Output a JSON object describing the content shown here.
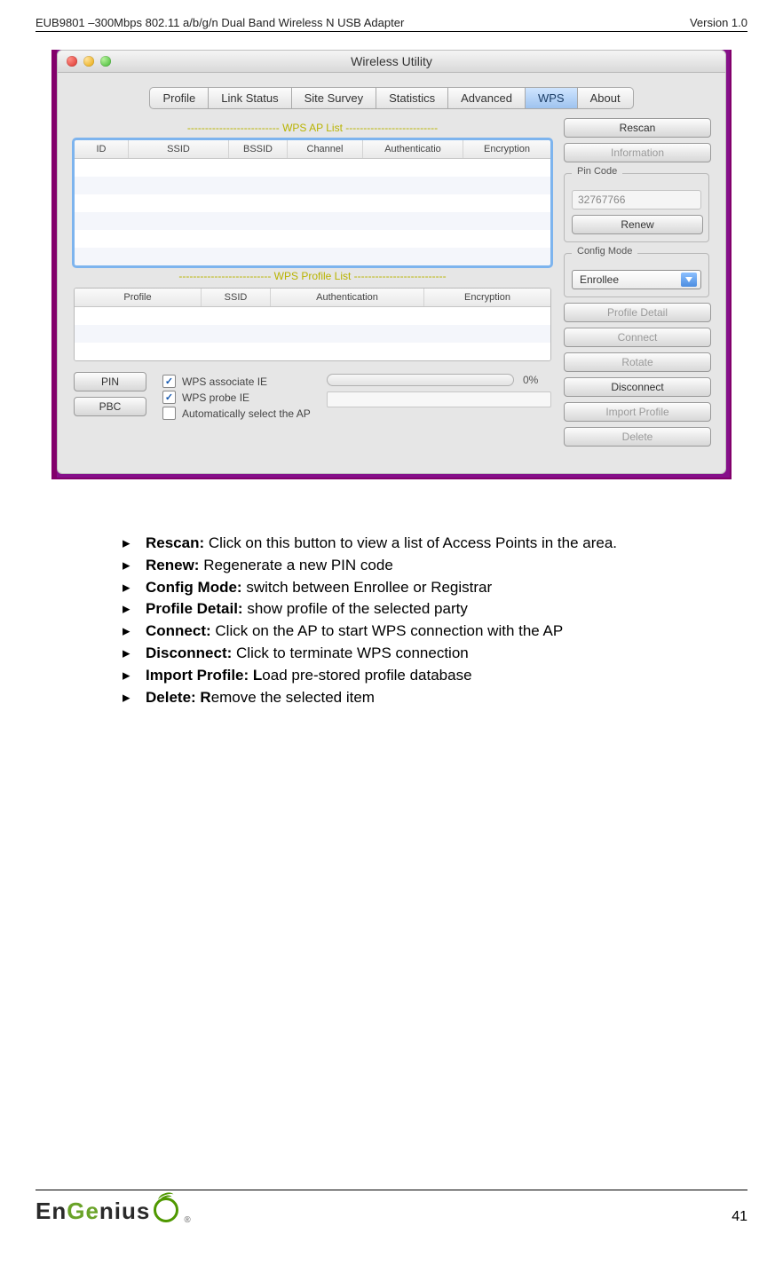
{
  "header": {
    "left": "EUB9801 –300Mbps 802.11 a/b/g/n Dual Band Wireless N USB Adapter",
    "right": "Version 1.0"
  },
  "window": {
    "title": "Wireless Utility",
    "tabs": [
      "Profile",
      "Link Status",
      "Site Survey",
      "Statistics",
      "Advanced",
      "WPS",
      "About"
    ],
    "activeTab": "WPS",
    "apListTitle": "-------------------------- WPS AP List --------------------------",
    "apCols": [
      "ID",
      "SSID",
      "BSSID",
      "Channel",
      "Authenticatio",
      "Encryption"
    ],
    "profileListTitle": "-------------------------- WPS Profile List --------------------------",
    "profileCols": [
      "Profile",
      "SSID",
      "Authentication",
      "Encryption"
    ],
    "side": {
      "rescan": "Rescan",
      "information": "Information",
      "pinCodeLabel": "Pin Code",
      "pinCode": "32767766",
      "renew": "Renew",
      "configModeLabel": "Config Mode",
      "configMode": "Enrollee",
      "profileDetail": "Profile Detail",
      "connect": "Connect",
      "rotate": "Rotate",
      "disconnect": "Disconnect",
      "importProfile": "Import Profile",
      "delete": "Delete"
    },
    "bottom": {
      "pinBtn": "PIN",
      "pbcBtn": "PBC",
      "chk1": "WPS associate IE",
      "chk2": "WPS probe IE",
      "chk3": "Automatically select the AP",
      "progress": "0%"
    }
  },
  "bullets": [
    {
      "b": "Rescan:",
      "t": " Click on this button to view a list of Access Points in the area."
    },
    {
      "b": "Renew:",
      "t": " Regenerate a new PIN code"
    },
    {
      "b": "Config Mode:",
      "t": " switch between Enrollee or Registrar"
    },
    {
      "b": "Profile Detail:",
      "t": " show profile of the selected party"
    },
    {
      "b": "Connect:",
      "t": " Click on the AP to start WPS connection with the AP"
    },
    {
      "b": "Disconnect:",
      "t": " Click to terminate WPS connection"
    },
    {
      "b": "Import Profile: L",
      "t": "oad pre-stored profile database"
    },
    {
      "b": "Delete: R",
      "t": "emove the selected item"
    }
  ],
  "footer": {
    "logoText": [
      "En",
      "Ge",
      "nius"
    ],
    "pageNum": "41"
  }
}
